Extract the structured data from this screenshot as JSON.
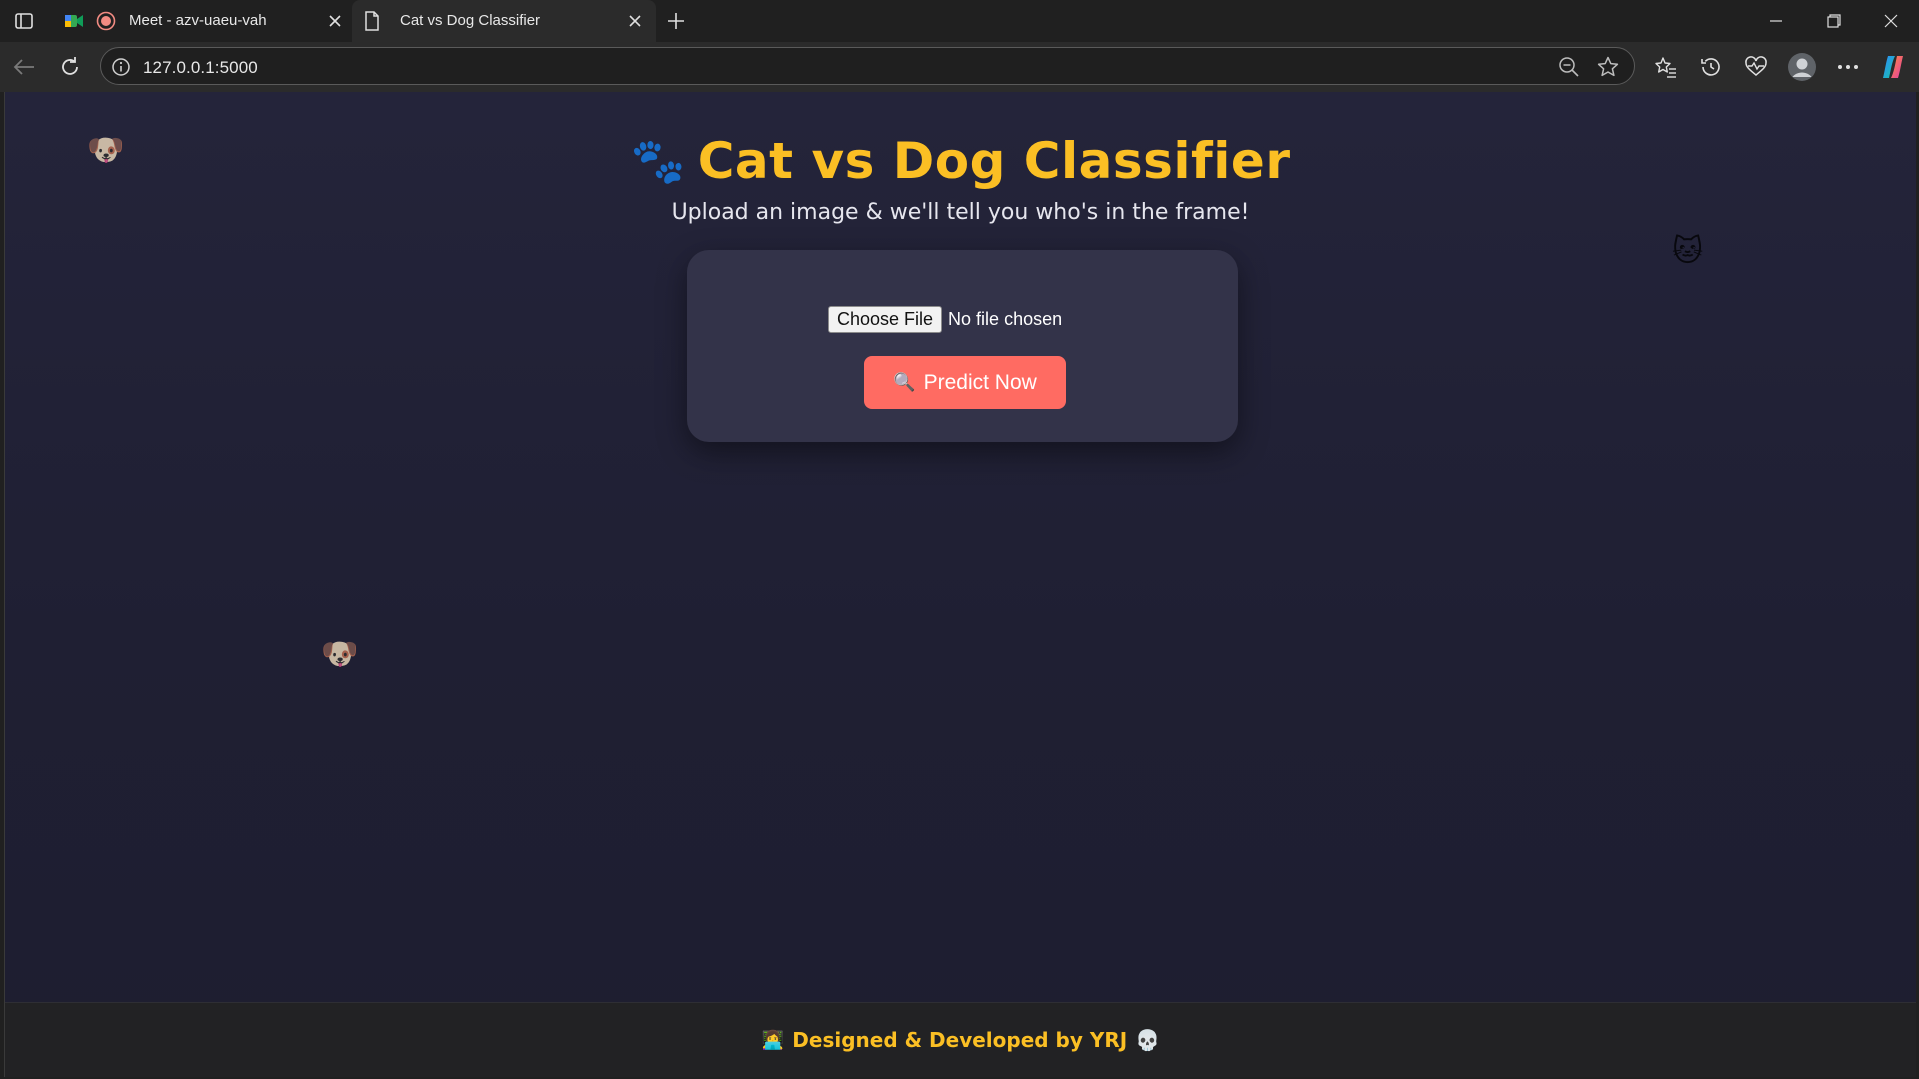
{
  "browser": {
    "tabs": [
      {
        "title": "Meet - azv-uaeu-vah",
        "state": "inactive",
        "icon": "google-meet-icon"
      },
      {
        "title": "Cat vs Dog Classifier",
        "state": "active",
        "icon": "document-icon"
      }
    ],
    "address": {
      "url": "127.0.0.1:5000"
    }
  },
  "page": {
    "heading_icon": "🐾",
    "title": "Cat vs Dog Classifier",
    "subtitle": "Upload an image & we'll tell you who's in the frame!",
    "upload": {
      "choose_label": "Choose File",
      "status": "No file chosen"
    },
    "predict": {
      "icon": "🔍",
      "label": "Predict Now"
    },
    "floaters": [
      "🐶",
      "🐱",
      "🐶"
    ],
    "footer": {
      "left_icon": "👩‍💻",
      "text": "Designed & Developed by YRJ",
      "right_icon": "💀"
    }
  },
  "colors": {
    "title": "#fbbf24",
    "predict_button": "#ff6b62",
    "card": "#333349",
    "background": "#24243a"
  }
}
